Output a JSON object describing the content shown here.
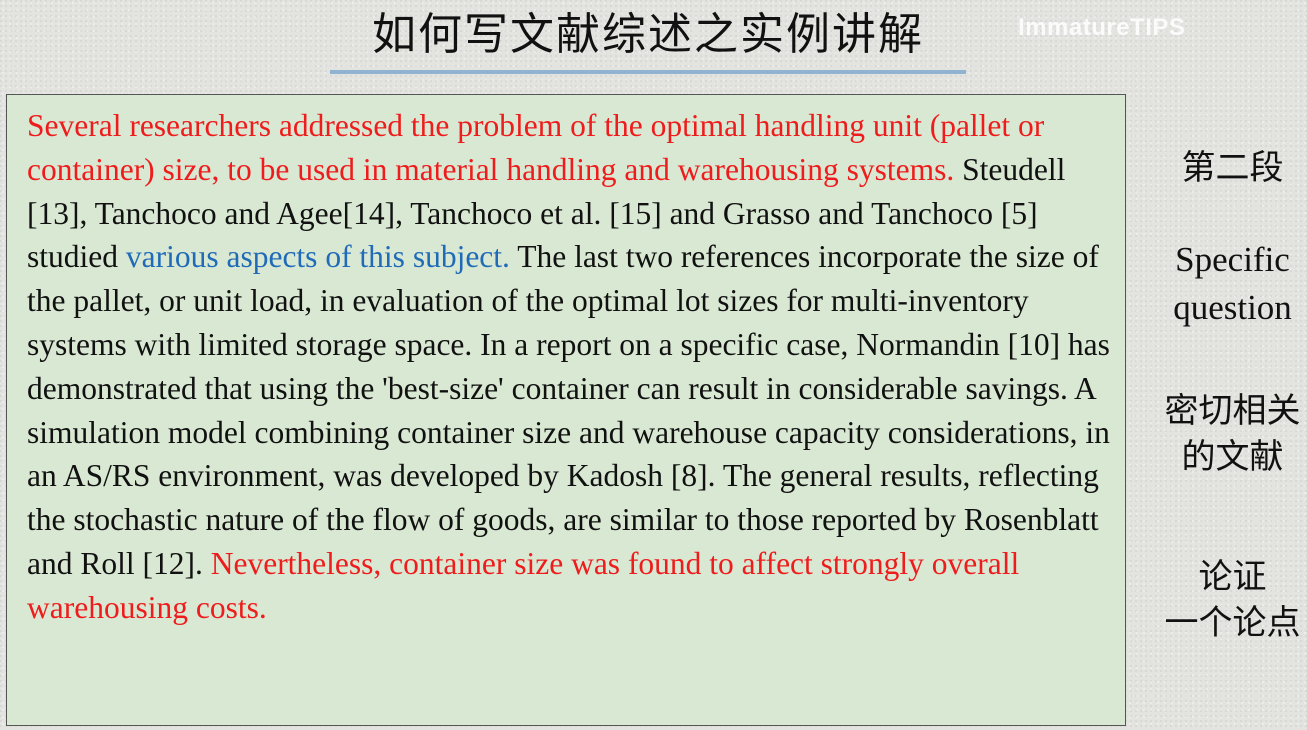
{
  "header": {
    "title": "如何写文献综述之实例讲解",
    "watermark": "ImmatureTIPS"
  },
  "paragraph": {
    "segments": [
      {
        "text": "Several researchers addressed the problem of the optimal handling unit (pallet or container) size, to be used in material handling and warehousing systems.",
        "color": "red"
      },
      {
        "text": " Steudell [13], Tanchoco and Agee[14], Tanchoco et al. [15] and Grasso and Tanchoco [5] studied ",
        "color": "black"
      },
      {
        "text": "various aspects of this subject.",
        "color": "blue"
      },
      {
        "text": " The last two references incorporate the size of the pallet, or unit load, in evaluation of the optimal lot sizes for multi-inventory systems with limited storage space. In a report on a specific case, Normandin [10] has demonstrated that using the 'best-size' container can result in considerable savings. A simulation model combining container size and warehouse capacity considerations, in an AS/RS environment, was developed by Kadosh [8]. The general results, reflecting the stochastic nature of the flow of goods, are similar to those reported by Rosenblatt and Roll [12].",
        "color": "black"
      },
      {
        "text": " Nevertheless, container size was found to affect strongly overall warehousing costs.",
        "color": "red"
      }
    ]
  },
  "sidebar": {
    "section": "第二段",
    "specific_line1": "Specific",
    "specific_line2": "question",
    "related_line1": "密切相关",
    "related_line2": "的文献",
    "argue_line1": "论证",
    "argue_line2": "一个论点"
  },
  "colors": {
    "red": "#ee1c1c",
    "blue": "#1f6bb8",
    "box_background": "#d9e8d3",
    "title_underline": "#8fb3d1"
  }
}
